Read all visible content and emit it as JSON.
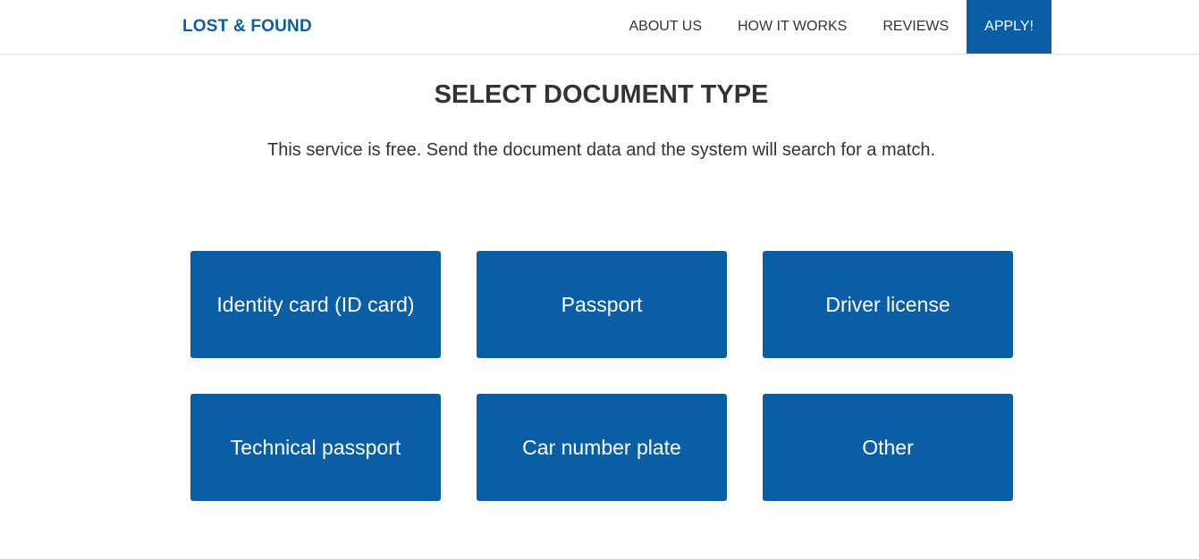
{
  "header": {
    "logo": "LOST & FOUND",
    "nav": [
      {
        "label": "ABOUT US"
      },
      {
        "label": "HOW IT WORKS"
      },
      {
        "label": "REVIEWS"
      },
      {
        "label": "APPLY!"
      }
    ]
  },
  "main": {
    "title": "SELECT DOCUMENT TYPE",
    "subtitle": "This service is free. Send the document data and the system will search for a match.",
    "document_types": [
      {
        "label": "Identity card (ID card)"
      },
      {
        "label": "Passport"
      },
      {
        "label": "Driver license"
      },
      {
        "label": "Technical passport"
      },
      {
        "label": "Car number plate"
      },
      {
        "label": "Other"
      }
    ]
  },
  "colors": {
    "brand": "#0a5ea5",
    "text": "#333333",
    "background": "#ffffff"
  }
}
